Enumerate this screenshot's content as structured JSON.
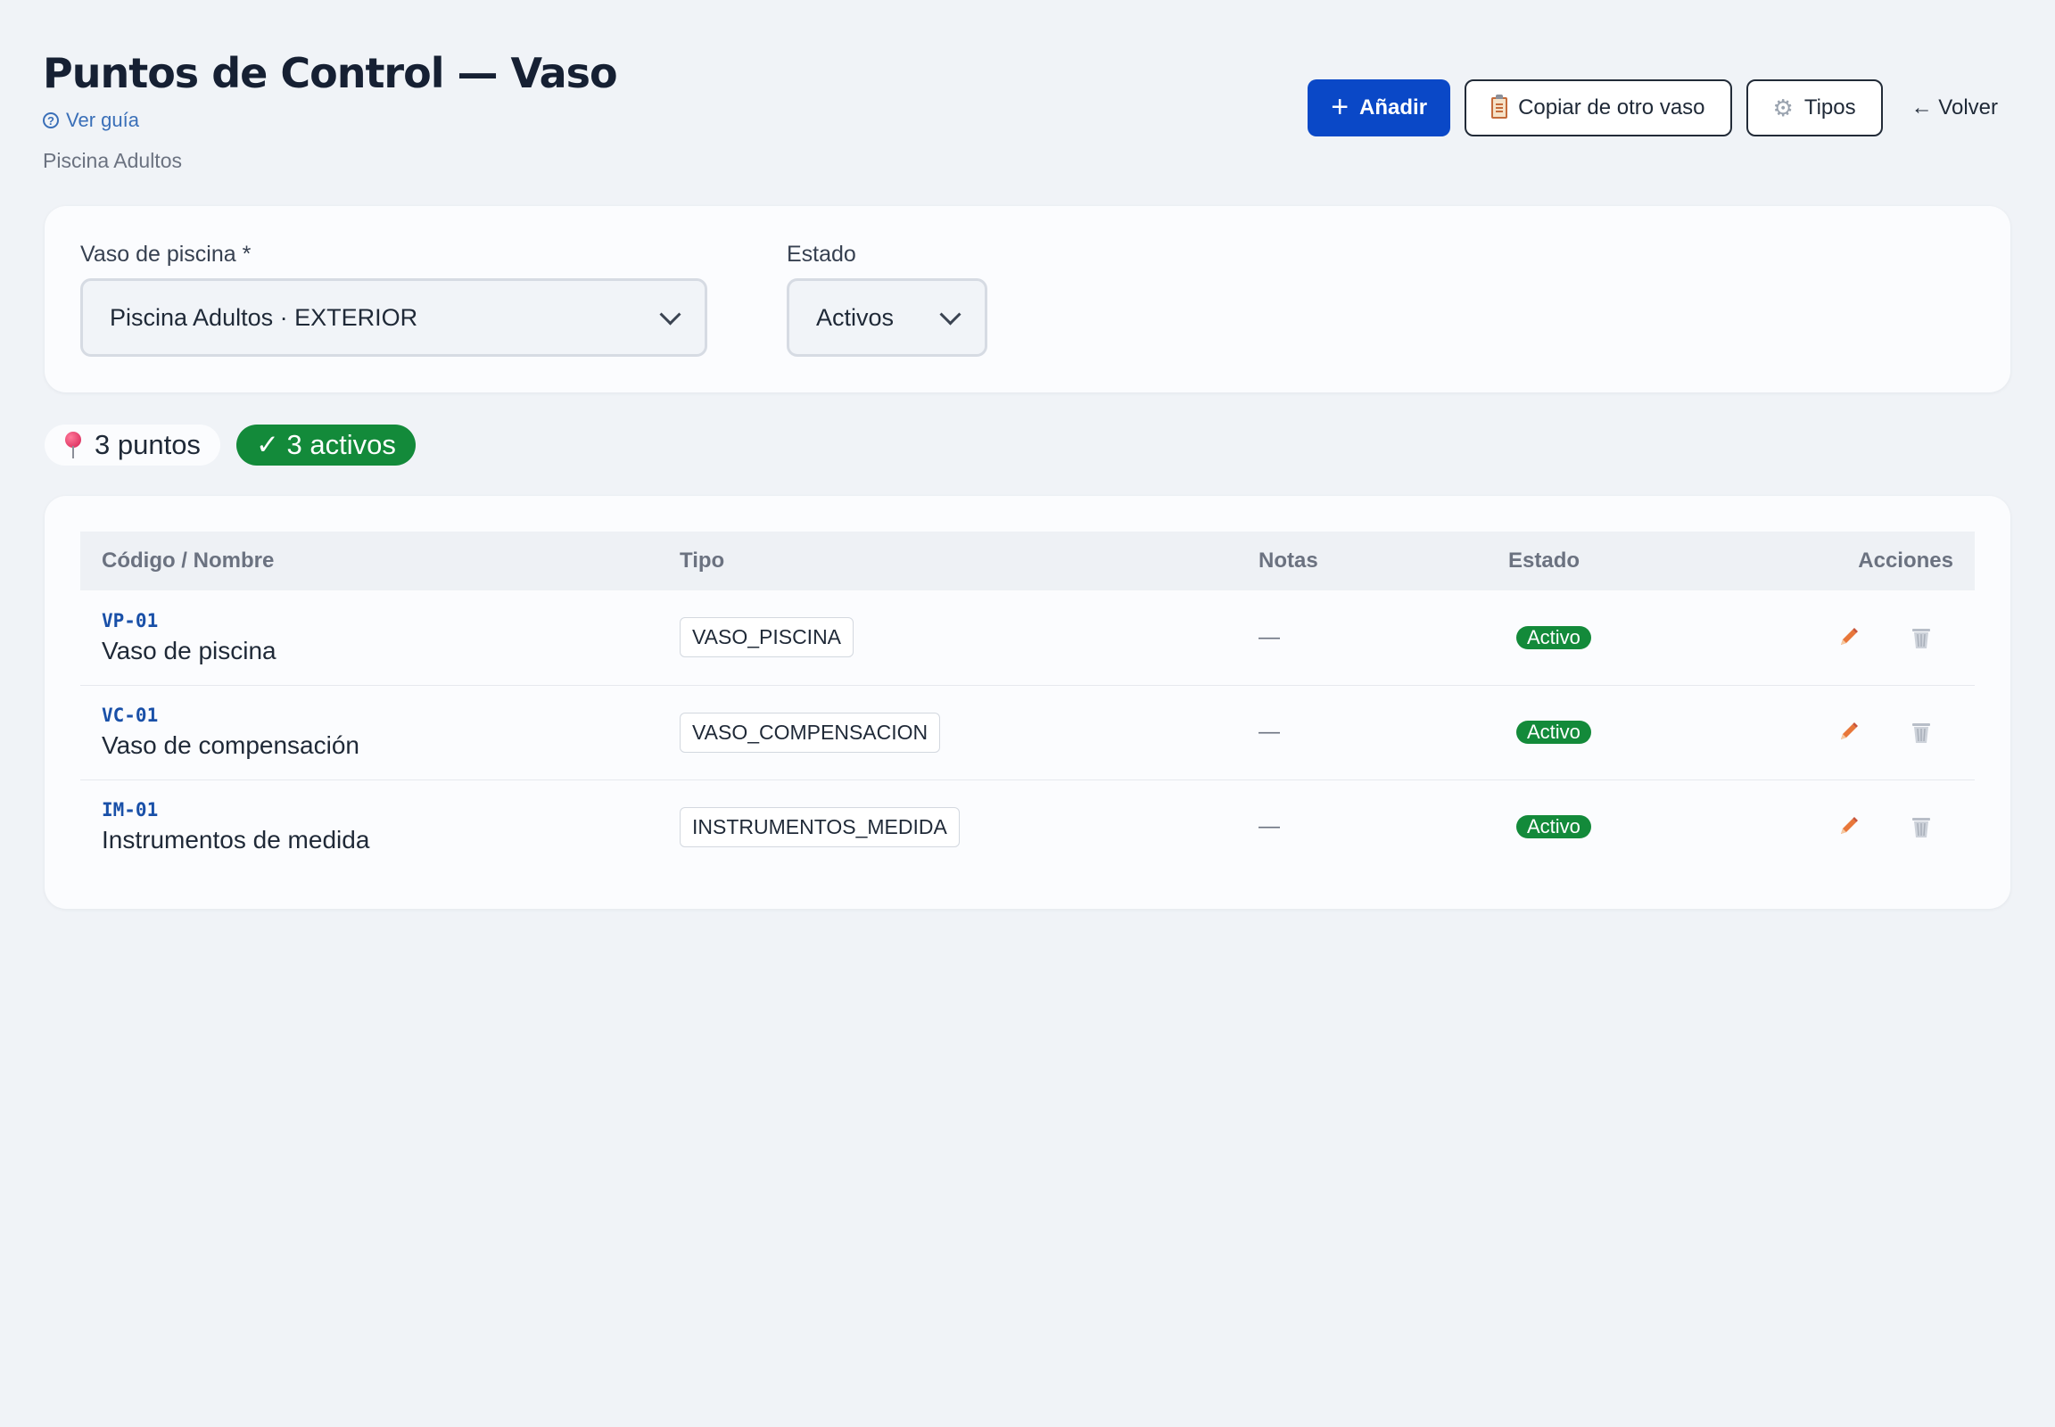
{
  "header": {
    "title": "Puntos de Control — Vaso",
    "guide_link": "Ver guía",
    "subtitle": "Piscina Adultos"
  },
  "actions": {
    "add_label": "Añadir",
    "copy_label": "Copiar de otro vaso",
    "types_label": "Tipos",
    "back_label": "← Volver"
  },
  "filters": {
    "vessel_label": "Vaso de piscina *",
    "vessel_value": "Piscina Adultos · EXTERIOR",
    "state_label": "Estado",
    "state_value": "Activos"
  },
  "summary": {
    "points": "3 puntos",
    "active": "✓ 3 activos"
  },
  "table": {
    "headers": {
      "code_name": "Código / Nombre",
      "type": "Tipo",
      "notes": "Notas",
      "state": "Estado",
      "actions": "Acciones"
    },
    "rows": [
      {
        "code": "VP-01",
        "name": "Vaso de piscina",
        "type": "VASO_PISCINA",
        "notes": "—",
        "status": "Activo"
      },
      {
        "code": "VC-01",
        "name": "Vaso de compensación",
        "type": "VASO_COMPENSACION",
        "notes": "—",
        "status": "Activo"
      },
      {
        "code": "IM-01",
        "name": "Instrumentos de medida",
        "type": "INSTRUMENTOS_MEDIDA",
        "notes": "—",
        "status": "Activo"
      }
    ]
  },
  "icons": {
    "guide": "question-circle-icon",
    "add": "plus-icon",
    "copy": "clipboard-icon",
    "types": "gear-icon",
    "points": "pushpin-icon",
    "edit": "pencil-icon",
    "delete": "trash-icon",
    "select": "chevron-down-icon"
  },
  "colors": {
    "primary": "#0a48c7",
    "success": "#138a3a",
    "code": "#1950a8",
    "link": "#3a6fb8",
    "edit_icon": "#e8773a",
    "delete_icon": "#b8bec8",
    "background": "#f0f3f7"
  }
}
